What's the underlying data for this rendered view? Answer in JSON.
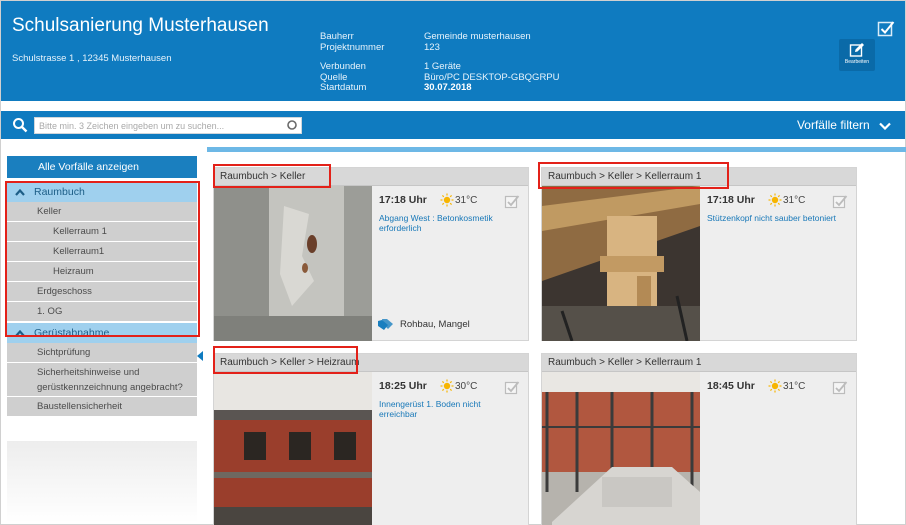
{
  "header": {
    "title": "Schulsanierung Musterhausen",
    "address": "Schulstrasse 1 , 12345 Musterhausen",
    "labels": [
      "Bauherr",
      "Projektnummer",
      "Verbunden",
      "Quelle",
      "Startdatum"
    ],
    "values": [
      "Gemeinde musterhausen",
      "123",
      "1 Geräte",
      "Büro/PC DESKTOP-GBQGRPU",
      "30.07.2018"
    ],
    "edit_label": "Bearbeiten"
  },
  "search": {
    "placeholder": "Bitte min. 3 Zeichen eingeben um zu suchen...",
    "filter_label": "Vorfälle filtern"
  },
  "sidebar": {
    "all_label": "Alle Vorfälle anzeigen",
    "groups": [
      {
        "label": "Raumbuch",
        "items": [
          {
            "label": "Keller",
            "level": 1
          },
          {
            "label": "Kellerraum 1",
            "level": 2
          },
          {
            "label": "Kellerraum1",
            "level": 2
          },
          {
            "label": "Heizraum",
            "level": 2
          },
          {
            "label": "Erdgeschoss",
            "level": 1
          },
          {
            "label": "1. OG",
            "level": 1
          }
        ]
      },
      {
        "label": "Gerüstabnahme",
        "items": [
          {
            "label": "Sichtprüfung",
            "level": 1
          },
          {
            "label": "Sicherheitshinweise und Gerüstkennzeichnung angebracht?",
            "lines": [
              "Sicherheitshinweise und",
              "gerüstkennzeichnung angebracht?"
            ],
            "level": 1
          },
          {
            "label": "Baustellensicherheit",
            "level": 1
          }
        ]
      }
    ]
  },
  "cards": [
    {
      "path": "Raumbuch > Keller",
      "time": "17:18 Uhr",
      "temp": "31°C",
      "desc": "Abgang West : Betonkosmetik erforderlich",
      "tags": "Rohbau, Mangel"
    },
    {
      "path": "Raumbuch > Keller > Kellerraum 1",
      "time": "17:18 Uhr",
      "temp": "31°C",
      "desc": "Stützenkopf nicht sauber betoniert",
      "tags": ""
    },
    {
      "path": "Raumbuch > Keller > Heizraum",
      "time": "18:25 Uhr",
      "temp": "30°C",
      "desc": "Innengerüst 1. Boden nicht erreichbar",
      "tags": ""
    },
    {
      "path": "Raumbuch > Keller > Kellerraum 1",
      "time": "18:45 Uhr",
      "temp": "31°C",
      "desc": "",
      "tags": ""
    }
  ],
  "colors": {
    "primary": "#0f7bc0",
    "highlight": "#e32119",
    "sidebar_group": "#9fd0ee",
    "sidebar_item": "#cfcfcf",
    "sun": "#f7b500"
  },
  "icons": {
    "search": "search-icon",
    "clear": "clear-icon",
    "chevron": "chevron-down-icon",
    "edit": "edit-icon",
    "sun": "sun-icon",
    "tag": "tag-icon",
    "check": "check-icon"
  }
}
